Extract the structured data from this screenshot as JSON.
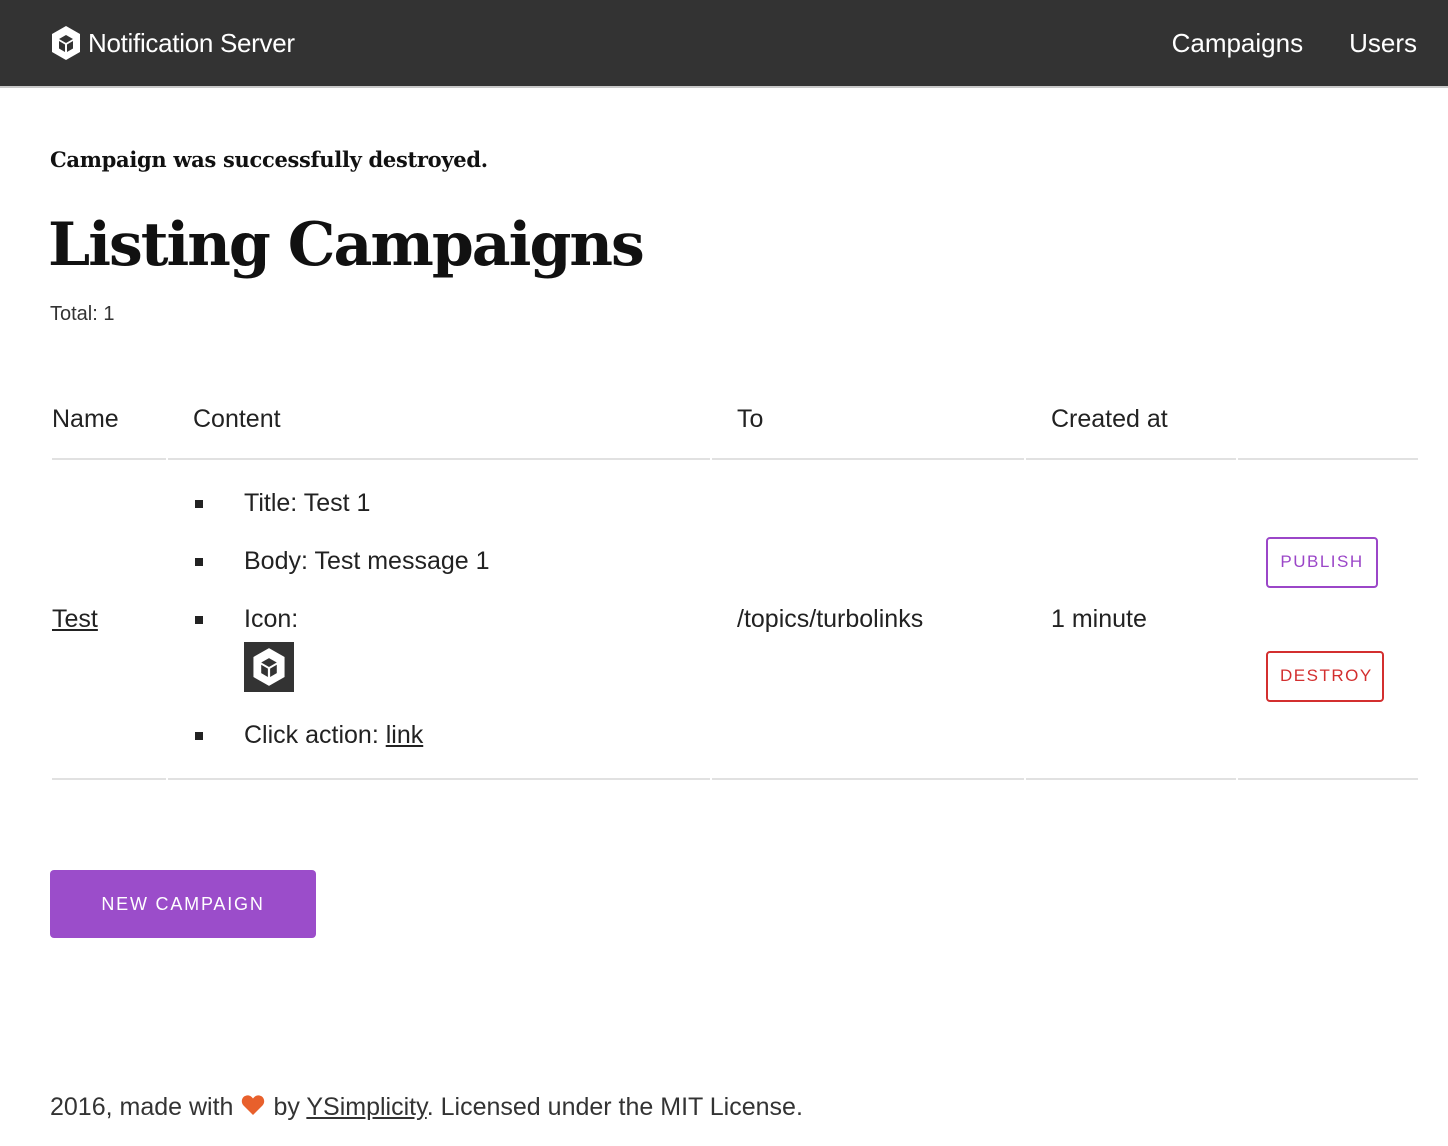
{
  "app": {
    "name": "Notification Server",
    "logo_icon": "cube-icon"
  },
  "nav": {
    "items": [
      {
        "label": "Campaigns"
      },
      {
        "label": "Users"
      }
    ]
  },
  "notice": "Campaign was successfully destroyed.",
  "page_title": "Listing Campaigns",
  "total": {
    "label": "Total:",
    "value": "1"
  },
  "table": {
    "headers": [
      "Name",
      "Content",
      "To",
      "Created at",
      ""
    ],
    "rows": [
      {
        "name": "Test",
        "content": {
          "title_label": "Title:",
          "title_value": "Test 1",
          "body_label": "Body:",
          "body_value": "Test message 1",
          "icon_label": "Icon:",
          "icon": "cube-icon",
          "click_action_label": "Click action:",
          "click_action_value": "link"
        },
        "to": "/topics/turbolinks",
        "created_at": "1 minute",
        "actions": {
          "publish": "PUBLISH",
          "destroy": "DESTROY"
        }
      }
    ]
  },
  "new_campaign_button": "NEW CAMPAIGN",
  "footer": {
    "prefix": "2016, made with",
    "heart_icon": "heart-icon",
    "by": "by",
    "link": "YSimplicity",
    "suffix": ". Licensed under the MIT License."
  },
  "colors": {
    "navbar": "#333333",
    "accent": "#9b4dca",
    "danger": "#d32f2f",
    "heart": "#e8602c"
  }
}
